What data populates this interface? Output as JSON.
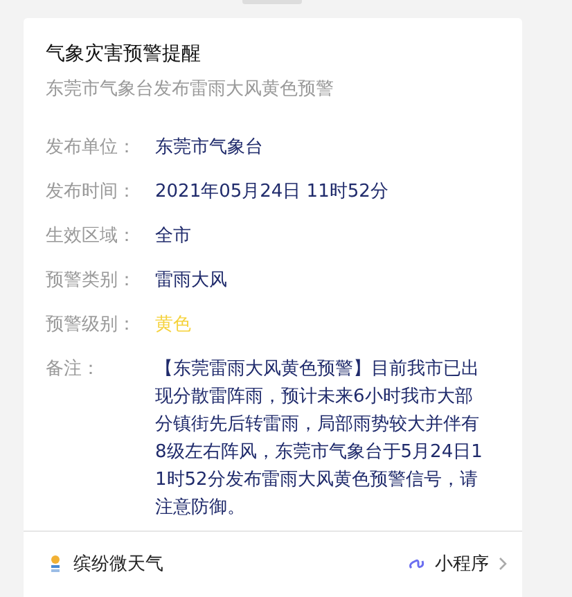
{
  "card": {
    "title": "气象灾害预警提醒",
    "subtitle": "东莞市气象台发布雷雨大风黄色预警",
    "fields": [
      {
        "label": "发布单位：",
        "value": "东莞市气象台",
        "color": "#1f2a6b"
      },
      {
        "label": "发布时间：",
        "value": "2021年05月24日 11时52分",
        "color": "#1f2a6b"
      },
      {
        "label": "生效区域：",
        "value": "全市",
        "color": "#1f2a6b"
      },
      {
        "label": "预警类别：",
        "value": "雷雨大风",
        "color": "#1f2a6b"
      },
      {
        "label": "预警级别：",
        "value": "黄色",
        "color": "#f5d23c"
      },
      {
        "label": "备注：",
        "value": "【东莞雷雨大风黄色预警】目前我市已出现分散雷阵雨，预计未来6小时我市大部分镇街先后转雷雨，局部雨势较大并伴有8级左右阵风，东莞市气象台于5月24日11时52分发布雷雨大风黄色预警信号，请注意防御。",
        "color": "#1f2a6b"
      }
    ],
    "footer": {
      "source": "缤纷微天气",
      "link": "小程序"
    }
  }
}
